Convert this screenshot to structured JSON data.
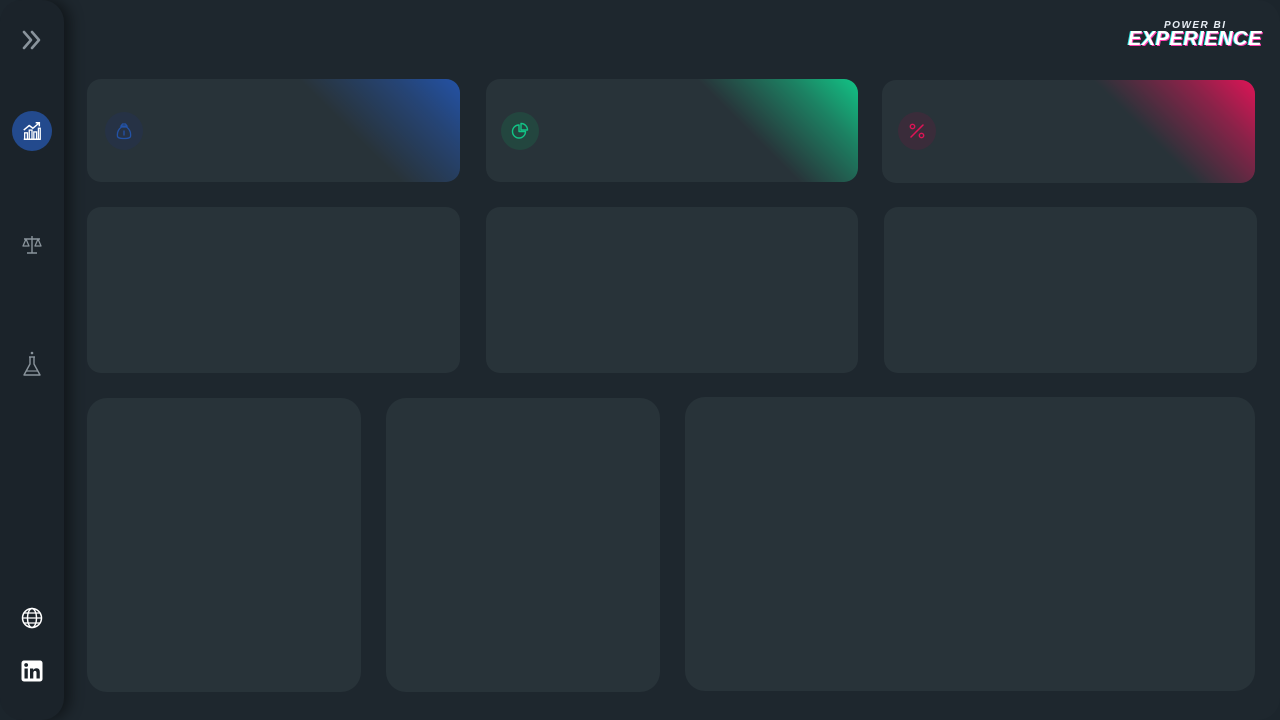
{
  "logo": {
    "top_text": "POWER BI",
    "main_text": "EXPERIENCE"
  },
  "sidebar": {
    "items": [
      {
        "name": "expand",
        "icon": "double-chevron-right-icon"
      },
      {
        "name": "performance",
        "icon": "bar-chart-trend-icon",
        "active": true
      },
      {
        "name": "balance",
        "icon": "scales-icon"
      },
      {
        "name": "lab",
        "icon": "flask-icon"
      },
      {
        "name": "website",
        "icon": "globe-icon"
      },
      {
        "name": "linkedin",
        "icon": "linkedin-icon"
      }
    ]
  },
  "kpis": [
    {
      "icon": "money-bag-icon",
      "accent": "#2352a6"
    },
    {
      "icon": "pie-chart-icon",
      "accent": "#12c486"
    },
    {
      "icon": "percent-icon",
      "accent": "#de1456"
    }
  ],
  "colors": {
    "background": "#1e272e",
    "card": "#283339",
    "sidebar": "#1b232a",
    "active": "#234a8d"
  }
}
